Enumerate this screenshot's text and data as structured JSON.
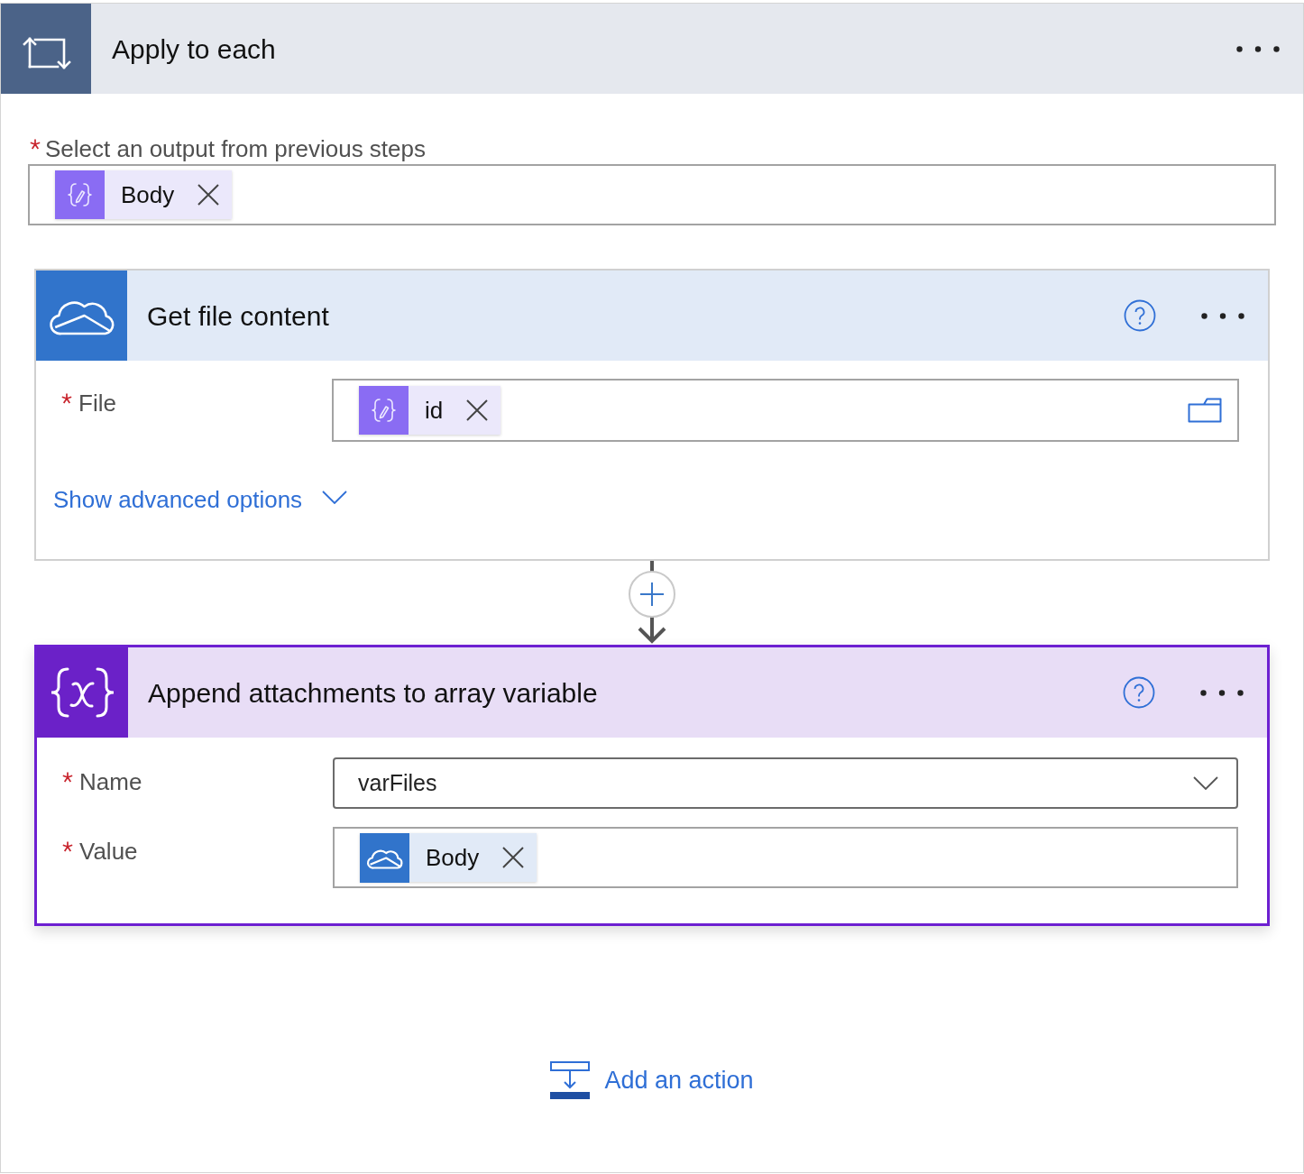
{
  "loop": {
    "title": "Apply to each",
    "field": {
      "label": "Select an output from previous steps",
      "required": true,
      "tokens": [
        {
          "kind": "expression",
          "label": "Body"
        }
      ]
    }
  },
  "actions": [
    {
      "kind": "onedrive",
      "title": "Get file content",
      "selected": false,
      "fields": [
        {
          "kind": "file",
          "label": "File",
          "required": true,
          "tokens": [
            {
              "kind": "expression",
              "label": "id"
            }
          ]
        }
      ],
      "advanced_link": "Show advanced options"
    },
    {
      "kind": "variable",
      "title": "Append attachments to array variable",
      "selected": true,
      "fields": [
        {
          "kind": "dropdown",
          "label": "Name",
          "required": true,
          "value": "varFiles"
        },
        {
          "kind": "tokens",
          "label": "Value",
          "required": true,
          "tokens": [
            {
              "kind": "onedrive",
              "label": "Body"
            }
          ]
        }
      ]
    }
  ],
  "add_action": {
    "label": "Add an action"
  }
}
